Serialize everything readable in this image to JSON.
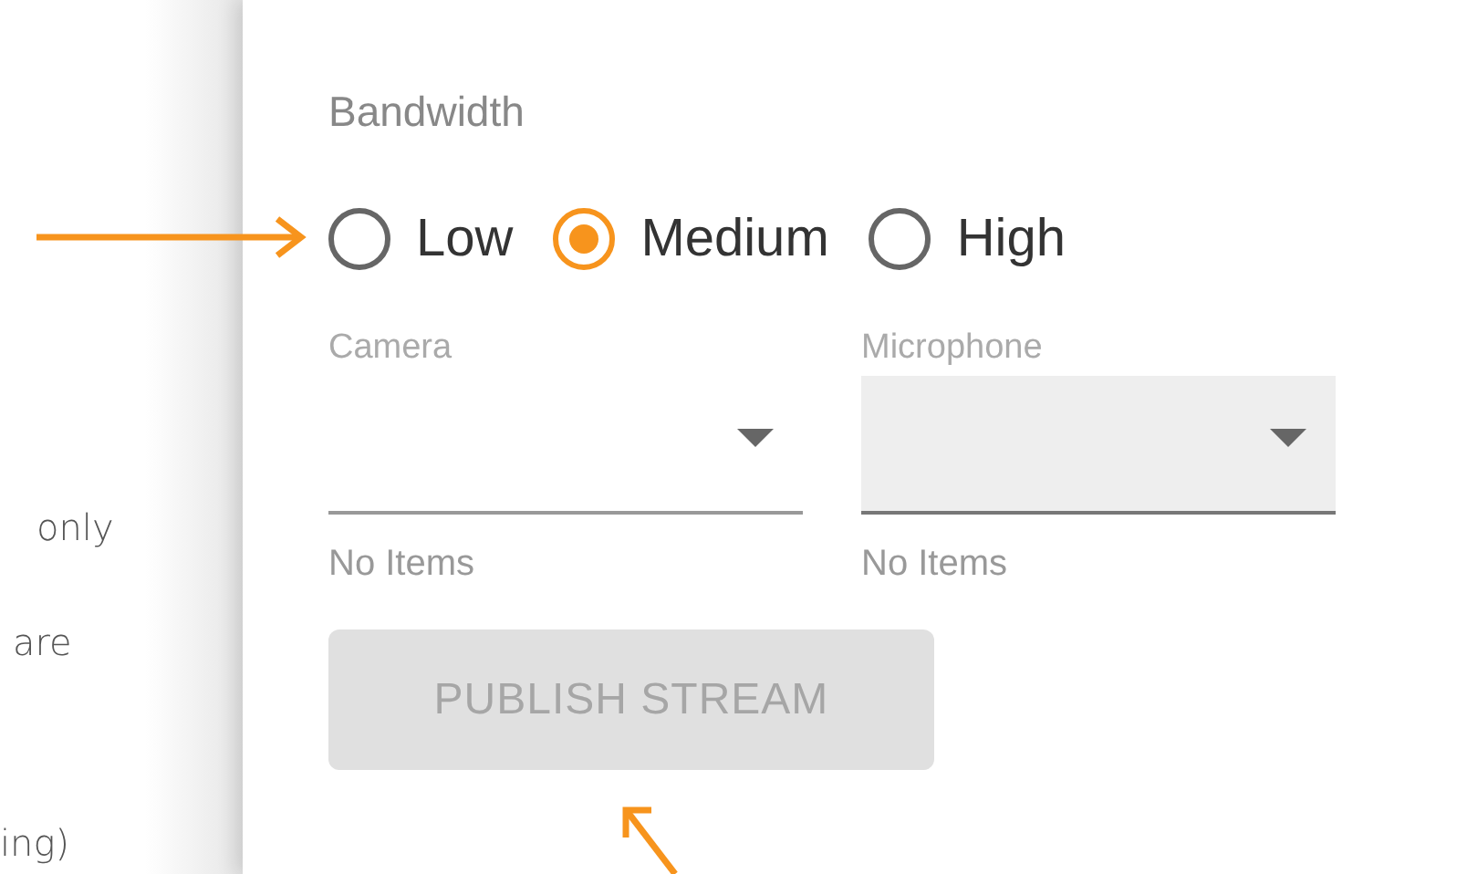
{
  "doc_text": [
    "only",
    "are",
    "ing)"
  ],
  "bandwidth": {
    "label": "Bandwidth",
    "options": [
      {
        "label": "Low",
        "selected": false
      },
      {
        "label": "Medium",
        "selected": true
      },
      {
        "label": "High",
        "selected": false
      }
    ]
  },
  "selects": [
    {
      "label": "Camera",
      "hint": "No Items",
      "highlighted": false
    },
    {
      "label": "Microphone",
      "hint": "No Items",
      "highlighted": true
    }
  ],
  "publish_button": {
    "label": "PUBLISH STREAM",
    "disabled": true
  }
}
